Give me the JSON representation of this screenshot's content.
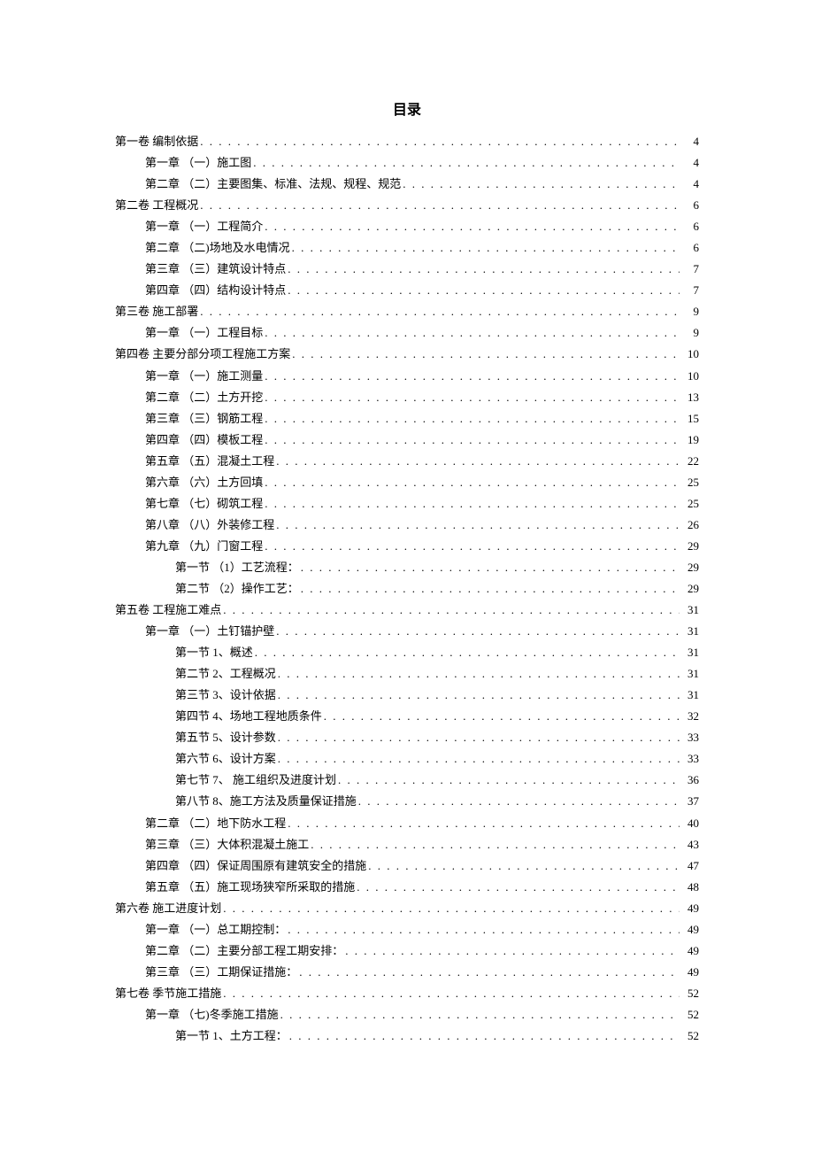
{
  "title": "目录",
  "entries": [
    {
      "level": 1,
      "label": "第一卷 编制依据",
      "page": "4"
    },
    {
      "level": 2,
      "label": "第一章 （一）施工图 ",
      "page": "4"
    },
    {
      "level": 2,
      "label": "第二章 （二）主要图集、标准、法规、规程、规范 ",
      "page": "4"
    },
    {
      "level": 1,
      "label": "第二卷 工程概况",
      "page": "6"
    },
    {
      "level": 2,
      "label": "第一章 （一）工程简介 ",
      "page": "6"
    },
    {
      "level": 2,
      "label": "第二章 （二)场地及水电情况 ",
      "page": "6"
    },
    {
      "level": 2,
      "label": "第三章 （三）建筑设计特点 ",
      "page": "7"
    },
    {
      "level": 2,
      "label": "第四章 （四）结构设计特点 ",
      "page": "7"
    },
    {
      "level": 1,
      "label": "第三卷 施工部署",
      "page": "9"
    },
    {
      "level": 2,
      "label": "第一章 （一）工程目标 ",
      "page": "9"
    },
    {
      "level": 1,
      "label": "第四卷 主要分部分项工程施工方案",
      "page": "10"
    },
    {
      "level": 2,
      "label": "第一章 （一）施工测量 ",
      "page": "10"
    },
    {
      "level": 2,
      "label": "第二章 （二）土方开挖 ",
      "page": "13"
    },
    {
      "level": 2,
      "label": "第三章 （三）钢筋工程 ",
      "page": "15"
    },
    {
      "level": 2,
      "label": "第四章 （四）模板工程 ",
      "page": "19"
    },
    {
      "level": 2,
      "label": "第五章 （五）混凝土工程 ",
      "page": "22"
    },
    {
      "level": 2,
      "label": "第六章 （六）土方回填 ",
      "page": "25"
    },
    {
      "level": 2,
      "label": "第七章 （七）砌筑工程 ",
      "page": "25"
    },
    {
      "level": 2,
      "label": "第八章 （八）外装修工程 ",
      "page": "26"
    },
    {
      "level": 2,
      "label": "第九章 （九）门窗工程 ",
      "page": "29"
    },
    {
      "level": 3,
      "label": "第一节 （1）工艺流程：",
      "page": "29"
    },
    {
      "level": 3,
      "label": "第二节 （2）操作工艺：",
      "page": "29"
    },
    {
      "level": 1,
      "label": "第五卷 工程施工难点",
      "page": "31"
    },
    {
      "level": 2,
      "label": "第一章 （一）土钉锚护壁 ",
      "page": "31"
    },
    {
      "level": 3,
      "label": "第一节 1、概述",
      "page": "31"
    },
    {
      "level": 3,
      "label": "第二节 2、工程概况",
      "page": "31"
    },
    {
      "level": 3,
      "label": "第三节 3、设计依据",
      "page": "31"
    },
    {
      "level": 3,
      "label": "第四节 4、场地工程地质条件",
      "page": "32"
    },
    {
      "level": 3,
      "label": "第五节 5、设计参数",
      "page": "33"
    },
    {
      "level": 3,
      "label": "第六节 6、设计方案",
      "page": "33"
    },
    {
      "level": 3,
      "label": "第七节 7、  施工组织及进度计划",
      "page": "36"
    },
    {
      "level": 3,
      "label": "第八节 8、施工方法及质量保证措施",
      "page": "37"
    },
    {
      "level": 2,
      "label": "第二章 （二）地下防水工程 ",
      "page": "40"
    },
    {
      "level": 2,
      "label": "第三章 （三）大体积混凝土施工 ",
      "page": "43"
    },
    {
      "level": 2,
      "label": "第四章 （四）保证周围原有建筑安全的措施 ",
      "page": "47"
    },
    {
      "level": 2,
      "label": "第五章 （五）施工现场狭窄所采取的措施 ",
      "page": "48"
    },
    {
      "level": 1,
      "label": "第六卷 施工进度计划",
      "page": "49"
    },
    {
      "level": 2,
      "label": "第一章 （一）总工期控制：",
      "page": "49"
    },
    {
      "level": 2,
      "label": "第二章 （二）主要分部工程工期安排：",
      "page": "49"
    },
    {
      "level": 2,
      "label": "第三章 （三）工期保证措施：",
      "page": "49"
    },
    {
      "level": 1,
      "label": "第七卷 季节施工措施",
      "page": "52"
    },
    {
      "level": 2,
      "label": "第一章 （七)冬季施工措施 ",
      "page": "52"
    },
    {
      "level": 3,
      "label": "第一节 1、土方工程：",
      "page": "52"
    }
  ]
}
